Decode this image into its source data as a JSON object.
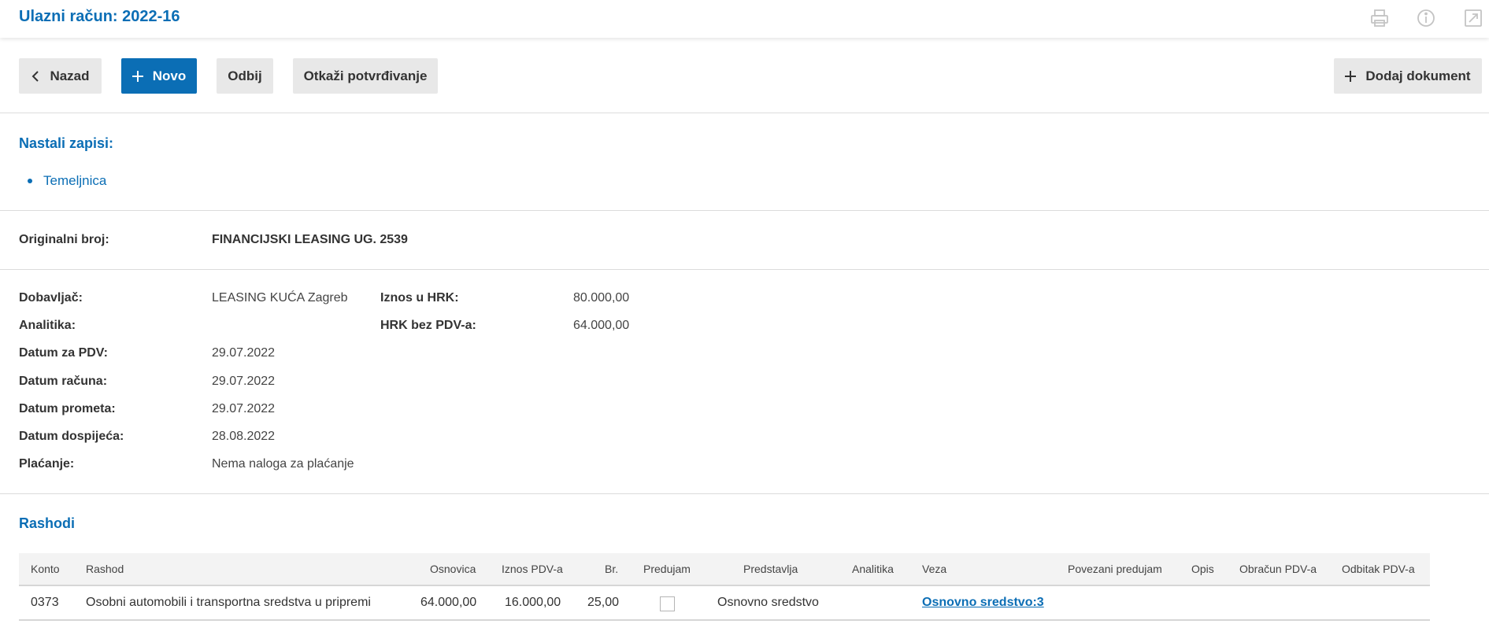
{
  "header": {
    "title": "Ulazni račun: 2022-16",
    "icons": [
      "print-icon",
      "info-icon",
      "external-link-icon"
    ]
  },
  "toolbar": {
    "back_label": "Nazad",
    "new_label": "Novo",
    "reject_label": "Odbij",
    "cancel_confirm_label": "Otkaži potvrđivanje",
    "add_document_label": "Dodaj dokument"
  },
  "records": {
    "title": "Nastali zapisi:",
    "items": [
      "Temeljnica"
    ]
  },
  "original": {
    "label": "Originalni broj:",
    "value": "FINANCIJSKI LEASING UG. 2539"
  },
  "details": {
    "supplier_label": "Dobavljač:",
    "supplier_value": "LEASING KUĆA Zagreb",
    "analytics_label": "Analitika:",
    "vat_date_label": "Datum za PDV:",
    "vat_date_value": "29.07.2022",
    "invoice_date_label": "Datum računa:",
    "invoice_date_value": "29.07.2022",
    "traffic_date_label": "Datum prometa:",
    "traffic_date_value": "29.07.2022",
    "due_date_label": "Datum dospijeća:",
    "due_date_value": "28.08.2022",
    "payment_label": "Plaćanje:",
    "payment_value": "Nema naloga za plaćanje",
    "amount_label": "Iznos u HRK:",
    "amount_value": "80.000,00",
    "net_label": "HRK bez PDV-a:",
    "net_value": "64.000,00"
  },
  "expenses": {
    "title": "Rashodi",
    "columns": [
      "Konto",
      "Rashod",
      "Osnovica",
      "Iznos PDV-a",
      "Br.",
      "Predujam",
      "Predstavlja",
      "Analitika",
      "Veza",
      "Povezani predujam",
      "Opis",
      "Obračun PDV-a",
      "Odbitak PDV-a"
    ],
    "rows": [
      {
        "konto": "0373",
        "rashod": "Osobni automobili i transportna sredstva u pripremi",
        "osnovica": "64.000,00",
        "iznos_pdv": "16.000,00",
        "br": "25,00",
        "predujam": false,
        "predstavlja": "Osnovno sredstvo",
        "veza": "Osnovno sredstvo:3"
      }
    ]
  },
  "colors": {
    "accent": "#0b6eb5",
    "button_gray": "#e8e8e8",
    "table_header_bg": "#f3f3f3"
  }
}
